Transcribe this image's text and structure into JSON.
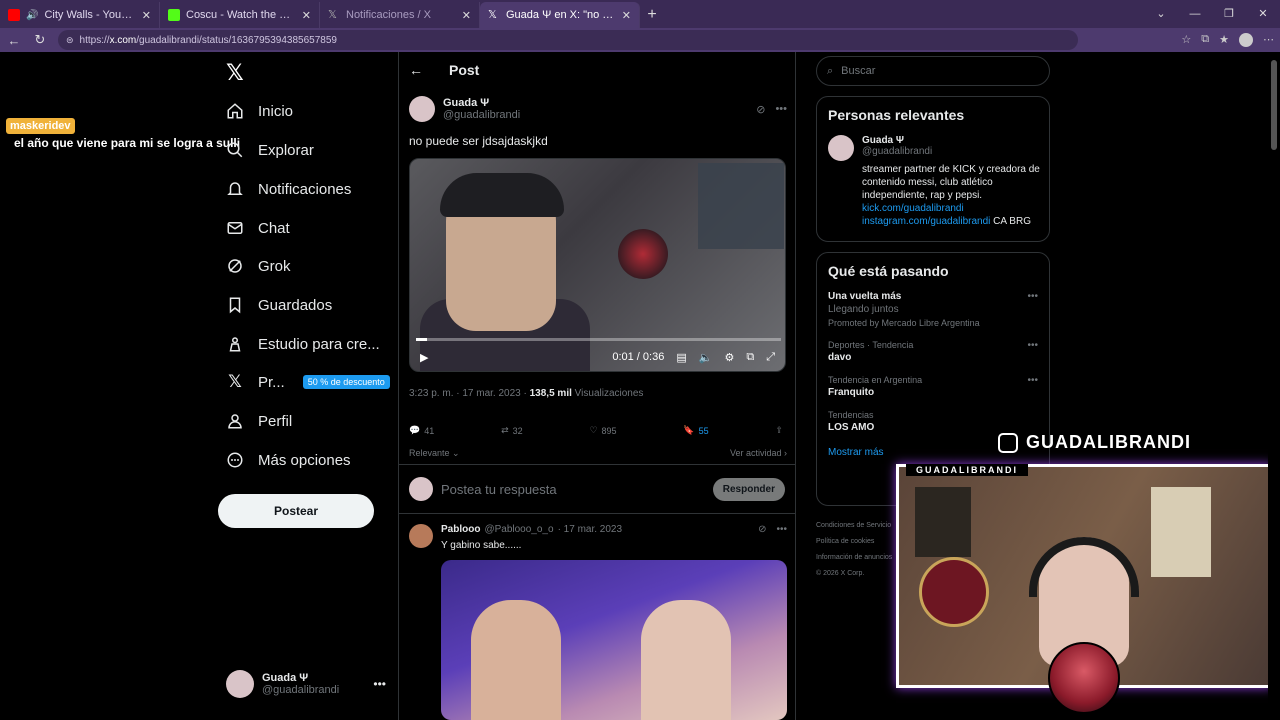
{
  "browser": {
    "tabs": [
      {
        "title": "City Walls - YouTube",
        "favicon_color": "#ff0000",
        "active": false,
        "audio": true
      },
      {
        "title": "Coscu - Watch the VOD on Kick",
        "favicon_color": "#53fc18",
        "active": false
      },
      {
        "title": "Notificaciones / X",
        "favicon_color": "#000000",
        "active": false
      },
      {
        "title": "Guada Ψ en X: \"no puede ser jdsajdaskjkd",
        "favicon_color": "#000000",
        "active": true
      }
    ],
    "url_prefix": "https://",
    "url_domain": "x.com",
    "url_path": "/guadalibrandi/status/1636795394385657859"
  },
  "overlay_chat": {
    "user": "maskeridev",
    "message": "el año que viene para mi se logra a sulli"
  },
  "nav": {
    "items": [
      {
        "label": "Inicio",
        "icon": "home-icon"
      },
      {
        "label": "Explorar",
        "icon": "search-icon"
      },
      {
        "label": "Notificaciones",
        "icon": "bell-icon"
      },
      {
        "label": "Chat",
        "icon": "mail-icon"
      },
      {
        "label": "Grok",
        "icon": "grok-icon"
      },
      {
        "label": "Guardados",
        "icon": "bookmark-icon"
      },
      {
        "label": "Estudio para cre...",
        "icon": "studio-icon"
      },
      {
        "label": "Pr...",
        "icon": "x-icon"
      },
      {
        "label": "Perfil",
        "icon": "person-icon"
      },
      {
        "label": "Más opciones",
        "icon": "more-circle-icon"
      }
    ],
    "promo": "50 % de descuento",
    "post_button": "Postear",
    "me_name": "Guada Ψ",
    "me_handle": "@guadalibrandi"
  },
  "post": {
    "header": "Post",
    "author": "Guada Ψ",
    "handle": "@guadalibrandi",
    "text": "no puede ser jdsajdaskjkd",
    "video_time": "0:01 / 0:36",
    "video_progress": 0.03,
    "time": "3:23 p. m. · 17 mar. 2023 · ",
    "views_count": "138,5 mil",
    "views_label": " Visualizaciones",
    "replies": "41",
    "reposts": "32",
    "likes": "895",
    "bookmarks": "55",
    "sort_label": "Relevante",
    "activity_label": "Ver actividad"
  },
  "reply_box": {
    "placeholder": "Postea tu respuesta",
    "button": "Responder"
  },
  "reply": {
    "author": "Pablooo",
    "handle": "@Pablooo_o_o",
    "date": "· 17 mar. 2023",
    "text": "Y gabino sabe......"
  },
  "right": {
    "search_placeholder": "Buscar",
    "relevant_title": "Personas relevantes",
    "rel_name": "Guada Ψ",
    "rel_handle": "@guadalibrandi",
    "rel_bio": "streamer partner de KICK y creadora de contenido messi, club atlético independiente, rap y pepsi.",
    "rel_link1": "kick.com/guadalibrandi",
    "rel_link2": "instagram.com/guadalibrandi",
    "rel_tail": " CA BRG",
    "trending_title": "Qué está pasando",
    "trends": [
      {
        "cat": "",
        "title": "Una vuelta más",
        "sub": "Llegando juntos",
        "promo": "Promoted by Mercado Libre Argentina"
      },
      {
        "cat": "Deportes · Tendencia",
        "title": "davo",
        "sub": "",
        "promo": ""
      },
      {
        "cat": "Tendencia en Argentina",
        "title": "Franquito",
        "sub": "",
        "promo": ""
      },
      {
        "cat": "Tendencias",
        "title": "LOS AMO",
        "sub": "",
        "promo": ""
      }
    ],
    "show_more": "Mostrar más",
    "footer": [
      "Condiciones de Servicio",
      "Política de cookies",
      "Información de anuncios",
      "© 2026 X Corp."
    ]
  },
  "stream": {
    "ig_handle": "GUADALIBRANDI",
    "cam_label": "GUADALIBRANDI"
  }
}
